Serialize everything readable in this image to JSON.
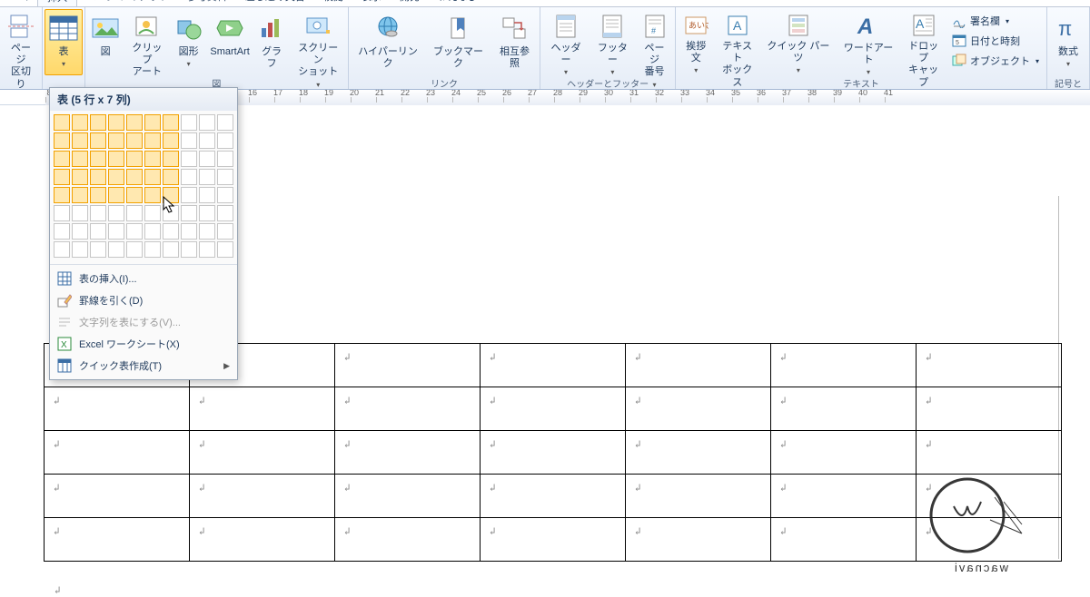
{
  "tabs": [
    "ム",
    "挿入",
    "ページ レイアウト",
    "参考資料",
    "差し込み文書",
    "校閲",
    "表示",
    "開発",
    "わえなび"
  ],
  "active_tab_index": 1,
  "ribbon": {
    "page_break": "ページ\n区切り",
    "table": "表",
    "picture": "図",
    "clipart": "クリップ\nアート",
    "shapes": "図形",
    "smartart": "SmartArt",
    "chart": "グラフ",
    "screenshot": "スクリーン\nショット",
    "hyperlink": "ハイパーリンク",
    "bookmark": "ブックマーク",
    "crossref": "相互参照",
    "header": "ヘッダー",
    "footer": "フッター",
    "pagenum": "ページ\n番号",
    "greeting": "挨拶文",
    "textbox": "テキスト\nボックス",
    "quickparts": "クイック パーツ",
    "wordart": "ワードアート",
    "dropcap": "ドロップ\nキャップ",
    "signature": "署名欄",
    "datetime": "日付と時刻",
    "object": "オブジェクト",
    "equation": "数式",
    "symbol_group": "記号と",
    "illustrations_group": "図",
    "links_group": "リンク",
    "headerfooter_group": "ヘッダーとフッター",
    "text_group": "テキスト"
  },
  "table_dropdown": {
    "title": "表 (5 行 x 7 列)",
    "rows": 8,
    "cols": 10,
    "sel_rows": 5,
    "sel_cols": 7,
    "insert_table": "表の挿入(I)...",
    "draw_table": "罫線を引く(D)",
    "convert_text": "文字列を表にする(V)...",
    "excel": "Excel ワークシート(X)",
    "quick_tables": "クイック表作成(T)"
  },
  "ruler_start": 8,
  "ruler_end": 41,
  "doc": {
    "table_rows": 5,
    "table_cols": 7,
    "cell_mark": "↲",
    "para_mark": "↲"
  },
  "watermark_text": "wacnavi"
}
